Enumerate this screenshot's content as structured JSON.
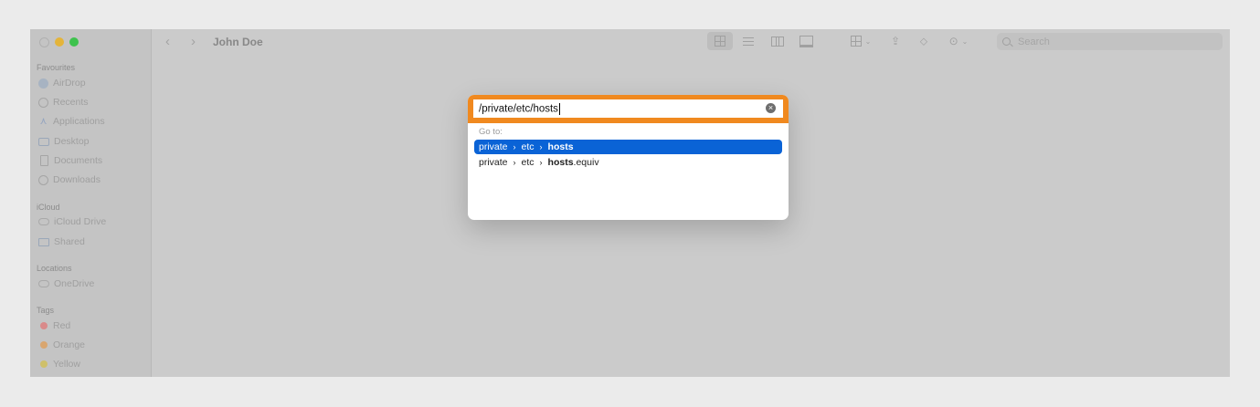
{
  "window": {
    "title": "John Doe"
  },
  "sidebar": {
    "favourites_title": "Favourites",
    "favourites": [
      {
        "label": "AirDrop",
        "icon": "airdrop-icon"
      },
      {
        "label": "Recents",
        "icon": "clock-icon"
      },
      {
        "label": "Applications",
        "icon": "applications-icon"
      },
      {
        "label": "Desktop",
        "icon": "desktop-icon"
      },
      {
        "label": "Documents",
        "icon": "document-icon"
      },
      {
        "label": "Downloads",
        "icon": "download-icon"
      }
    ],
    "icloud_title": "iCloud",
    "icloud": [
      {
        "label": "iCloud Drive",
        "icon": "cloud-icon"
      },
      {
        "label": "Shared",
        "icon": "shared-folder-icon"
      }
    ],
    "locations_title": "Locations",
    "locations": [
      {
        "label": "OneDrive",
        "icon": "cloud-icon"
      }
    ],
    "tags_title": "Tags",
    "tags": [
      {
        "label": "Red",
        "color": "#d98a8a"
      },
      {
        "label": "Orange",
        "color": "#d9a670"
      },
      {
        "label": "Yellow",
        "color": "#cfc06a"
      }
    ]
  },
  "toolbar": {
    "back_icon": "chevron-left-icon",
    "forward_icon": "chevron-right-icon",
    "search_placeholder": "Search"
  },
  "goto_dialog": {
    "path_value": "/private/etc/hosts",
    "goto_label": "Go to:",
    "suggestions": [
      {
        "parts": [
          "private",
          "etc"
        ],
        "match": "hosts",
        "suffix": "",
        "selected": true
      },
      {
        "parts": [
          "private",
          "etc"
        ],
        "match": "hosts",
        "suffix": ".equiv",
        "selected": false
      }
    ],
    "separator": "›",
    "highlight_color": "#f0891f",
    "selection_color": "#0a63d6"
  }
}
